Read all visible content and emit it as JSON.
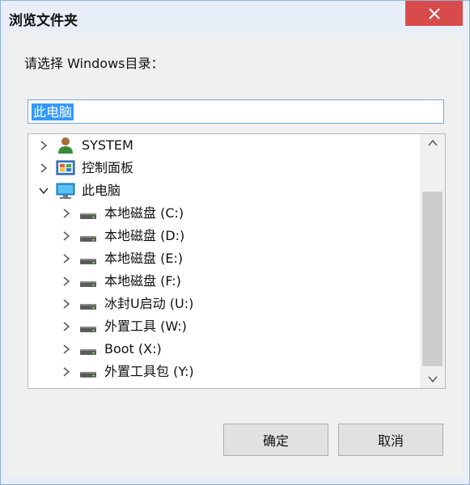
{
  "window": {
    "title": "浏览文件夹"
  },
  "dialog": {
    "prompt": "请选择 Windows目录：",
    "path_value": "此电脑"
  },
  "tree": {
    "items": [
      {
        "label": "SYSTEM",
        "icon": "user-folder-icon",
        "expander": "chevron-right"
      },
      {
        "label": "控制面板",
        "icon": "control-panel-icon",
        "expander": "chevron-right"
      },
      {
        "label": "此电脑",
        "icon": "computer-icon",
        "expander": "chevron-down"
      },
      {
        "label": "本地磁盘 (C:)",
        "icon": "drive-icon",
        "expander": "chevron-right"
      },
      {
        "label": "本地磁盘 (D:)",
        "icon": "drive-icon",
        "expander": "chevron-right"
      },
      {
        "label": "本地磁盘 (E:)",
        "icon": "drive-icon",
        "expander": "chevron-right"
      },
      {
        "label": "本地磁盘 (F:)",
        "icon": "drive-icon",
        "expander": "chevron-right"
      },
      {
        "label": "冰封U启动 (U:)",
        "icon": "drive-icon",
        "expander": "chevron-right"
      },
      {
        "label": "外置工具 (W:)",
        "icon": "drive-icon",
        "expander": "chevron-right"
      },
      {
        "label": "Boot (X:)",
        "icon": "drive-icon",
        "expander": "chevron-right"
      },
      {
        "label": "外置工具包 (Y:)",
        "icon": "drive-icon",
        "expander": "chevron-right"
      }
    ]
  },
  "buttons": {
    "ok_label": "确定",
    "cancel_label": "取消"
  },
  "colors": {
    "close_button": "#d74b4b",
    "selection": "#3399ff",
    "window_frame": "#e7eef7"
  }
}
